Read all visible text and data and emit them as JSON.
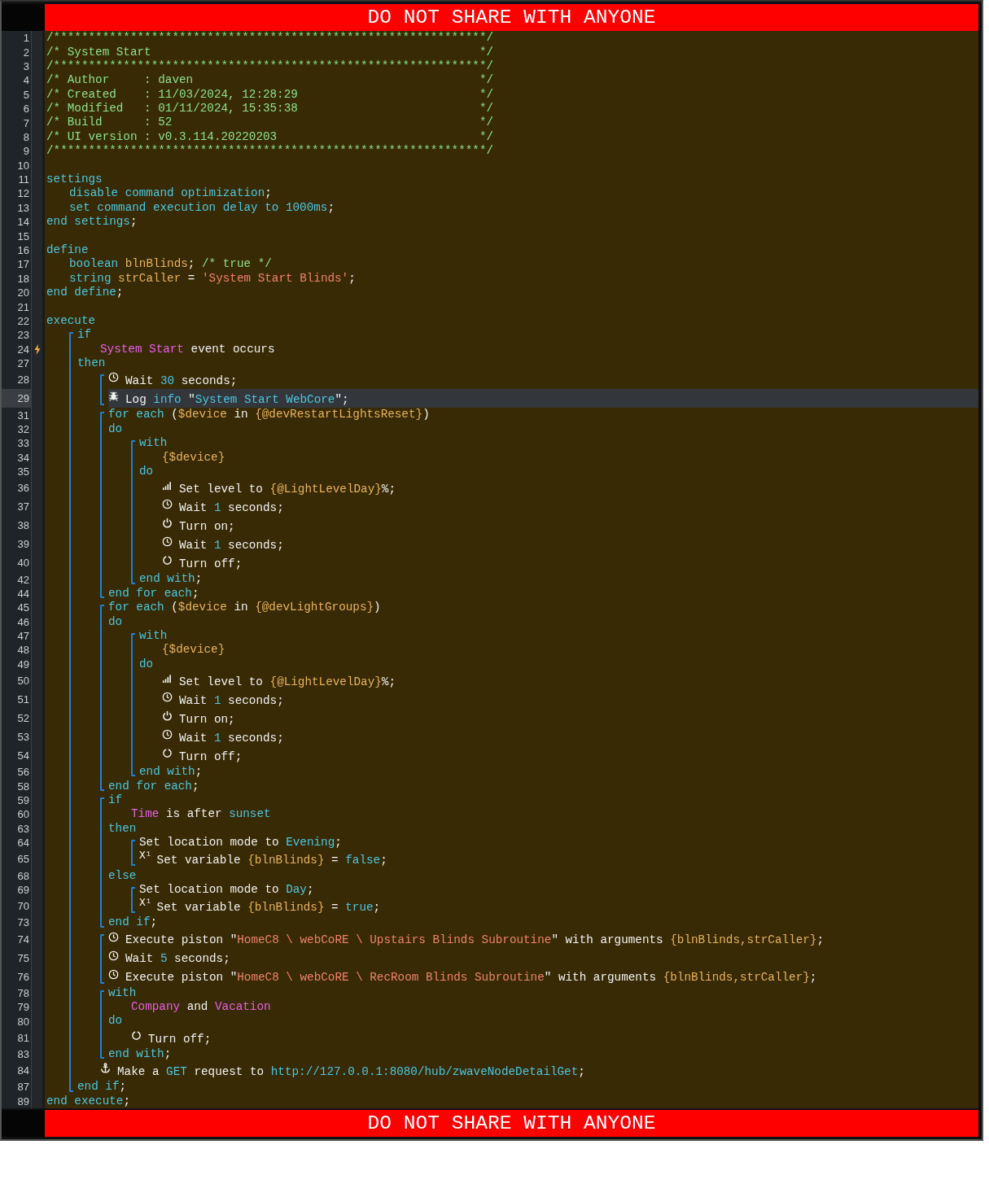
{
  "banner_top": "DO NOT SHARE WITH ANYONE",
  "code": [
    {
      "kind": "line",
      "num": "1",
      "highlighted": false,
      "tokens": [
        {
          "kind": "comment",
          "text": "/**************************************************************/"
        }
      ]
    },
    {
      "kind": "line",
      "num": "2",
      "highlighted": false,
      "tokens": [
        {
          "kind": "comment",
          "text": "/* System Start"
        }
      ],
      "closing": "*/"
    },
    {
      "kind": "line",
      "num": "3",
      "highlighted": false,
      "tokens": [
        {
          "kind": "comment",
          "text": "/**************************************************************/"
        }
      ]
    },
    {
      "kind": "line",
      "num": "4",
      "highlighted": false,
      "tokens": [
        {
          "kind": "comment",
          "text": "/* Author     : daven"
        }
      ],
      "closing": "*/"
    },
    {
      "kind": "line",
      "num": "5",
      "highlighted": false,
      "tokens": [
        {
          "kind": "comment",
          "text": "/* Created    : 11/03/2024, 12:28:29"
        }
      ],
      "closing": "*/"
    },
    {
      "kind": "line",
      "num": "6",
      "highlighted": false,
      "tokens": [
        {
          "kind": "comment",
          "text": "/* Modified   : 01/11/2024, 15:35:38"
        }
      ],
      "closing": "*/"
    },
    {
      "kind": "line",
      "num": "7",
      "highlighted": false,
      "tokens": [
        {
          "kind": "comment",
          "text": "/* Build      : 52"
        }
      ],
      "closing": "*/"
    },
    {
      "kind": "line",
      "num": "8",
      "highlighted": false,
      "tokens": [
        {
          "kind": "comment",
          "text": "/* UI version : v0.3.114.20220203"
        }
      ],
      "closing": "*/"
    },
    {
      "kind": "line",
      "num": "9",
      "highlighted": false,
      "tokens": [
        {
          "kind": "comment",
          "text": "/**************************************************************/"
        }
      ]
    },
    {
      "kind": "line",
      "num": "10",
      "highlighted": false
    },
    {
      "kind": "line",
      "num": "11",
      "highlighted": false,
      "tokens": [
        {
          "kind": "keyword",
          "text": "settings"
        }
      ],
      "children": [
        {
          "kind": "line",
          "num": "12",
          "highlighted": false,
          "tokens": [
            {
              "kind": "keyword",
              "text": "disable command optimization"
            },
            {
              "kind": "text",
              "text": ";"
            }
          ]
        },
        {
          "kind": "line",
          "num": "13",
          "highlighted": false,
          "tokens": [
            {
              "kind": "keyword",
              "text": "set command execution delay to 1000ms"
            },
            {
              "kind": "text",
              "text": ";"
            }
          ]
        }
      ]
    },
    {
      "kind": "line",
      "num": "14",
      "highlighted": false,
      "tokens": [
        {
          "kind": "keyword",
          "text": "end settings"
        },
        {
          "kind": "text",
          "text": ";"
        }
      ]
    },
    {
      "kind": "line",
      "num": "15",
      "highlighted": false
    },
    {
      "kind": "line",
      "num": "16",
      "highlighted": false,
      "tokens": [
        {
          "kind": "keyword",
          "text": "define"
        }
      ],
      "children": [
        {
          "kind": "line",
          "num": "17",
          "highlighted": false,
          "tokens": [
            {
              "kind": "keyword",
              "text": "boolean "
            },
            {
              "kind": "variable",
              "text": "blnBlinds"
            },
            {
              "kind": "text",
              "text": "; "
            },
            {
              "kind": "comment",
              "text": "/* true */"
            }
          ]
        },
        {
          "kind": "line",
          "num": "18",
          "highlighted": false,
          "tokens": [
            {
              "kind": "keyword",
              "text": "string "
            },
            {
              "kind": "variable",
              "text": "strCaller"
            },
            {
              "kind": "text",
              "text": " = "
            },
            {
              "kind": "string",
              "text": "'System Start Blinds'"
            },
            {
              "kind": "text",
              "text": ";"
            }
          ]
        }
      ]
    },
    {
      "kind": "line",
      "num": "20",
      "highlighted": false,
      "tokens": [
        {
          "kind": "keyword",
          "text": "end define"
        },
        {
          "kind": "text",
          "text": ";"
        }
      ]
    },
    {
      "kind": "line",
      "num": "21",
      "highlighted": false
    },
    {
      "kind": "line",
      "num": "22",
      "highlighted": false,
      "tokens": [
        {
          "kind": "keyword",
          "text": "execute"
        }
      ],
      "children": [
        {
          "kind": "block",
          "children": [
            {
              "kind": "line",
              "num": "23",
              "highlighted": false,
              "tokens": [
                {
                  "kind": "keyword",
                  "text": "if"
                }
              ],
              "children": [
                {
                  "kind": "trigger",
                  "num": "24",
                  "highlighted": false,
                  "tokens": [
                    {
                      "kind": "device",
                      "text": "System Start"
                    },
                    {
                      "kind": "text",
                      "text": " event occurs"
                    }
                  ]
                }
              ]
            },
            {
              "kind": "line",
              "num": "27",
              "highlighted": false,
              "tokens": [
                {
                  "kind": "keyword",
                  "text": "then"
                }
              ],
              "children": [
                {
                  "kind": "block",
                  "children": [
                    {
                      "kind": "wait",
                      "num": "28",
                      "highlighted": false,
                      "tokens": [
                        {
                          "kind": "text",
                          "text": "Wait "
                        },
                        {
                          "kind": "value",
                          "text": "30"
                        },
                        {
                          "kind": "text",
                          "text": " seconds;"
                        }
                      ]
                    },
                    {
                      "kind": "log",
                      "num": "29",
                      "highlighted": true,
                      "tokens": [
                        {
                          "kind": "text",
                          "text": "Log "
                        },
                        {
                          "kind": "value",
                          "text": "info"
                        },
                        {
                          "kind": "text",
                          "text": " \""
                        },
                        {
                          "kind": "value",
                          "text": "System Start WebCore"
                        },
                        {
                          "kind": "text",
                          "text": "\";"
                        }
                      ]
                    }
                  ]
                },
                {
                  "kind": "block",
                  "children": [
                    {
                      "kind": "line",
                      "num": "31",
                      "highlighted": false,
                      "tokens": [
                        {
                          "kind": "keyword",
                          "text": "for each "
                        },
                        {
                          "kind": "text",
                          "text": "("
                        },
                        {
                          "kind": "variable",
                          "text": "$device"
                        },
                        {
                          "kind": "text",
                          "text": " in "
                        },
                        {
                          "kind": "variable",
                          "text": "{@devRestartLightsReset}"
                        },
                        {
                          "kind": "text",
                          "text": ")"
                        }
                      ]
                    },
                    {
                      "kind": "line",
                      "num": "32",
                      "highlighted": false,
                      "tokens": [
                        {
                          "kind": "keyword",
                          "text": "do"
                        }
                      ],
                      "children": [
                        {
                          "kind": "block",
                          "children": [
                            {
                              "kind": "line",
                              "num": "33",
                              "highlighted": false,
                              "tokens": [
                                {
                                  "kind": "keyword",
                                  "text": "with"
                                }
                              ],
                              "children": [
                                {
                                  "kind": "line",
                                  "num": "34",
                                  "highlighted": false,
                                  "tokens": [
                                    {
                                      "kind": "variable",
                                      "text": "{$device}"
                                    }
                                  ]
                                }
                              ]
                            },
                            {
                              "kind": "line",
                              "num": "35",
                              "highlighted": false,
                              "tokens": [
                                {
                                  "kind": "keyword",
                                  "text": "do"
                                }
                              ],
                              "children": [
                                {
                                  "kind": "level",
                                  "num": "36",
                                  "highlighted": false,
                                  "tokens": [
                                    {
                                      "kind": "text",
                                      "text": "Set level to "
                                    },
                                    {
                                      "kind": "variable",
                                      "text": "{@LightLevelDay}"
                                    },
                                    {
                                      "kind": "text",
                                      "text": "%;"
                                    }
                                  ]
                                },
                                {
                                  "kind": "wait",
                                  "num": "37",
                                  "highlighted": false,
                                  "tokens": [
                                    {
                                      "kind": "text",
                                      "text": "Wait "
                                    },
                                    {
                                      "kind": "value",
                                      "text": "1"
                                    },
                                    {
                                      "kind": "text",
                                      "text": " seconds;"
                                    }
                                  ]
                                },
                                {
                                  "kind": "switch_on",
                                  "num": "38",
                                  "highlighted": false,
                                  "tokens": [
                                    {
                                      "kind": "text",
                                      "text": "Turn on;"
                                    }
                                  ]
                                },
                                {
                                  "kind": "wait",
                                  "num": "39",
                                  "highlighted": false,
                                  "tokens": [
                                    {
                                      "kind": "text",
                                      "text": "Wait "
                                    },
                                    {
                                      "kind": "value",
                                      "text": "1"
                                    },
                                    {
                                      "kind": "text",
                                      "text": " seconds;"
                                    }
                                  ]
                                },
                                {
                                  "kind": "switch_off",
                                  "num": "40",
                                  "highlighted": false,
                                  "tokens": [
                                    {
                                      "kind": "text",
                                      "text": "Turn off;"
                                    }
                                  ]
                                }
                              ]
                            },
                            {
                              "kind": "line",
                              "num": "42",
                              "highlighted": false,
                              "tokens": [
                                {
                                  "kind": "keyword",
                                  "text": "end with"
                                },
                                {
                                  "kind": "text",
                                  "text": ";"
                                }
                              ]
                            }
                          ]
                        }
                      ]
                    },
                    {
                      "kind": "line",
                      "num": "44",
                      "highlighted": false,
                      "tokens": [
                        {
                          "kind": "keyword",
                          "text": "end for each"
                        },
                        {
                          "kind": "text",
                          "text": ";"
                        }
                      ]
                    }
                  ]
                },
                {
                  "kind": "block",
                  "children": [
                    {
                      "kind": "line",
                      "num": "45",
                      "highlighted": false,
                      "tokens": [
                        {
                          "kind": "keyword",
                          "text": "for each "
                        },
                        {
                          "kind": "text",
                          "text": "("
                        },
                        {
                          "kind": "variable",
                          "text": "$device"
                        },
                        {
                          "kind": "text",
                          "text": " in "
                        },
                        {
                          "kind": "variable",
                          "text": "{@devLightGroups}"
                        },
                        {
                          "kind": "text",
                          "text": ")"
                        }
                      ]
                    },
                    {
                      "kind": "line",
                      "num": "46",
                      "highlighted": false,
                      "tokens": [
                        {
                          "kind": "keyword",
                          "text": "do"
                        }
                      ],
                      "children": [
                        {
                          "kind": "block",
                          "children": [
                            {
                              "kind": "line",
                              "num": "47",
                              "highlighted": false,
                              "tokens": [
                                {
                                  "kind": "keyword",
                                  "text": "with"
                                }
                              ],
                              "children": [
                                {
                                  "kind": "line",
                                  "num": "48",
                                  "highlighted": false,
                                  "tokens": [
                                    {
                                      "kind": "variable",
                                      "text": "{$device}"
                                    }
                                  ]
                                }
                              ]
                            },
                            {
                              "kind": "line",
                              "num": "49",
                              "highlighted": false,
                              "tokens": [
                                {
                                  "kind": "keyword",
                                  "text": "do"
                                }
                              ],
                              "children": [
                                {
                                  "kind": "level",
                                  "num": "50",
                                  "highlighted": false,
                                  "tokens": [
                                    {
                                      "kind": "text",
                                      "text": "Set level to "
                                    },
                                    {
                                      "kind": "variable",
                                      "text": "{@LightLevelDay}"
                                    },
                                    {
                                      "kind": "text",
                                      "text": "%;"
                                    }
                                  ]
                                },
                                {
                                  "kind": "wait",
                                  "num": "51",
                                  "highlighted": false,
                                  "tokens": [
                                    {
                                      "kind": "text",
                                      "text": "Wait "
                                    },
                                    {
                                      "kind": "value",
                                      "text": "1"
                                    },
                                    {
                                      "kind": "text",
                                      "text": " seconds;"
                                    }
                                  ]
                                },
                                {
                                  "kind": "switch_on",
                                  "num": "52",
                                  "highlighted": false,
                                  "tokens": [
                                    {
                                      "kind": "text",
                                      "text": "Turn on;"
                                    }
                                  ]
                                },
                                {
                                  "kind": "wait",
                                  "num": "53",
                                  "highlighted": false,
                                  "tokens": [
                                    {
                                      "kind": "text",
                                      "text": "Wait "
                                    },
                                    {
                                      "kind": "value",
                                      "text": "1"
                                    },
                                    {
                                      "kind": "text",
                                      "text": " seconds;"
                                    }
                                  ]
                                },
                                {
                                  "kind": "switch_off",
                                  "num": "54",
                                  "highlighted": false,
                                  "tokens": [
                                    {
                                      "kind": "text",
                                      "text": "Turn off;"
                                    }
                                  ]
                                }
                              ]
                            },
                            {
                              "kind": "line",
                              "num": "56",
                              "highlighted": false,
                              "tokens": [
                                {
                                  "kind": "keyword",
                                  "text": "end with"
                                },
                                {
                                  "kind": "text",
                                  "text": ";"
                                }
                              ]
                            }
                          ]
                        }
                      ]
                    },
                    {
                      "kind": "line",
                      "num": "58",
                      "highlighted": false,
                      "tokens": [
                        {
                          "kind": "keyword",
                          "text": "end for each"
                        },
                        {
                          "kind": "text",
                          "text": ";"
                        }
                      ]
                    }
                  ]
                },
                {
                  "kind": "block",
                  "children": [
                    {
                      "kind": "line",
                      "num": "59",
                      "highlighted": false,
                      "tokens": [
                        {
                          "kind": "keyword",
                          "text": "if"
                        }
                      ],
                      "children": [
                        {
                          "kind": "line",
                          "num": "60",
                          "highlighted": false,
                          "tokens": [
                            {
                              "kind": "device",
                              "text": "Time"
                            },
                            {
                              "kind": "text",
                              "text": " is after "
                            },
                            {
                              "kind": "value",
                              "text": "sunset"
                            }
                          ]
                        }
                      ]
                    },
                    {
                      "kind": "line",
                      "num": "63",
                      "highlighted": false,
                      "tokens": [
                        {
                          "kind": "keyword",
                          "text": "then"
                        }
                      ],
                      "children": [
                        {
                          "kind": "block",
                          "children": [
                            {
                              "kind": "line",
                              "num": "64",
                              "highlighted": false,
                              "tokens": [
                                {
                                  "kind": "text",
                                  "text": "Set location mode to "
                                },
                                {
                                  "kind": "value",
                                  "text": "Evening"
                                },
                                {
                                  "kind": "text",
                                  "text": ";"
                                }
                              ]
                            },
                            {
                              "kind": "variable",
                              "num": "65",
                              "highlighted": false,
                              "glyph": "X¹",
                              "tokens": [
                                {
                                  "kind": "text",
                                  "text": "Set variable "
                                },
                                {
                                  "kind": "variable",
                                  "text": "{blnBlinds}"
                                },
                                {
                                  "kind": "text",
                                  "text": " = "
                                },
                                {
                                  "kind": "value",
                                  "text": "false"
                                },
                                {
                                  "kind": "text",
                                  "text": ";"
                                }
                              ]
                            }
                          ]
                        }
                      ]
                    },
                    {
                      "kind": "line",
                      "num": "68",
                      "highlighted": false,
                      "tokens": [
                        {
                          "kind": "keyword",
                          "text": "else"
                        }
                      ],
                      "children": [
                        {
                          "kind": "block",
                          "children": [
                            {
                              "kind": "line",
                              "num": "69",
                              "highlighted": false,
                              "tokens": [
                                {
                                  "kind": "text",
                                  "text": "Set location mode to "
                                },
                                {
                                  "kind": "value",
                                  "text": "Day"
                                },
                                {
                                  "kind": "text",
                                  "text": ";"
                                }
                              ]
                            },
                            {
                              "kind": "variable",
                              "num": "70",
                              "highlighted": false,
                              "glyph": "X¹",
                              "tokens": [
                                {
                                  "kind": "text",
                                  "text": "Set variable "
                                },
                                {
                                  "kind": "variable",
                                  "text": "{blnBlinds}"
                                },
                                {
                                  "kind": "text",
                                  "text": " = "
                                },
                                {
                                  "kind": "value",
                                  "text": "true"
                                },
                                {
                                  "kind": "text",
                                  "text": ";"
                                }
                              ]
                            }
                          ]
                        }
                      ]
                    },
                    {
                      "kind": "line",
                      "num": "73",
                      "highlighted": false,
                      "tokens": [
                        {
                          "kind": "keyword",
                          "text": "end if"
                        },
                        {
                          "kind": "text",
                          "text": ";"
                        }
                      ]
                    }
                  ]
                },
                {
                  "kind": "block",
                  "children": [
                    {
                      "kind": "wait",
                      "num": "74",
                      "highlighted": false,
                      "tokens": [
                        {
                          "kind": "text",
                          "text": "Execute piston \""
                        },
                        {
                          "kind": "string",
                          "text": "HomeC8 \\ webCoRE \\ Upstairs Blinds Subroutine"
                        },
                        {
                          "kind": "text",
                          "text": "\" with arguments "
                        },
                        {
                          "kind": "variable",
                          "text": "{blnBlinds,strCaller}"
                        },
                        {
                          "kind": "text",
                          "text": ";"
                        }
                      ]
                    },
                    {
                      "kind": "wait",
                      "num": "75",
                      "highlighted": false,
                      "tokens": [
                        {
                          "kind": "text",
                          "text": "Wait "
                        },
                        {
                          "kind": "value",
                          "text": "5"
                        },
                        {
                          "kind": "text",
                          "text": " seconds;"
                        }
                      ]
                    },
                    {
                      "kind": "wait",
                      "num": "76",
                      "highlighted": false,
                      "tokens": [
                        {
                          "kind": "text",
                          "text": "Execute piston \""
                        },
                        {
                          "kind": "string",
                          "text": "HomeC8 \\ webCoRE \\ RecRoom Blinds Subroutine"
                        },
                        {
                          "kind": "text",
                          "text": "\" with arguments "
                        },
                        {
                          "kind": "variable",
                          "text": "{blnBlinds,strCaller}"
                        },
                        {
                          "kind": "text",
                          "text": ";"
                        }
                      ]
                    }
                  ]
                },
                {
                  "kind": "block",
                  "children": [
                    {
                      "kind": "line",
                      "num": "78",
                      "highlighted": false,
                      "tokens": [
                        {
                          "kind": "keyword",
                          "text": "with"
                        }
                      ],
                      "children": [
                        {
                          "kind": "line",
                          "num": "79",
                          "highlighted": false,
                          "tokens": [
                            {
                              "kind": "device",
                              "text": "Company"
                            },
                            {
                              "kind": "text",
                              "text": " and "
                            },
                            {
                              "kind": "device",
                              "text": "Vacation"
                            }
                          ]
                        }
                      ]
                    },
                    {
                      "kind": "line",
                      "num": "80",
                      "highlighted": false,
                      "tokens": [
                        {
                          "kind": "keyword",
                          "text": "do"
                        }
                      ],
                      "children": [
                        {
                          "kind": "switch_off",
                          "num": "81",
                          "highlighted": false,
                          "tokens": [
                            {
                              "kind": "text",
                              "text": "Turn off;"
                            }
                          ]
                        }
                      ]
                    },
                    {
                      "kind": "line",
                      "num": "83",
                      "highlighted": false,
                      "tokens": [
                        {
                          "kind": "keyword",
                          "text": "end with"
                        },
                        {
                          "kind": "text",
                          "text": ";"
                        }
                      ]
                    }
                  ]
                },
                {
                  "kind": "request",
                  "num": "84",
                  "highlighted": false,
                  "tokens": [
                    {
                      "kind": "text",
                      "text": "Make a "
                    },
                    {
                      "kind": "value",
                      "text": "GET"
                    },
                    {
                      "kind": "text",
                      "text": " request to "
                    },
                    {
                      "kind": "value",
                      "text": "http://127.0.0.1:8080/hub/zwaveNodeDetailGet"
                    },
                    {
                      "kind": "text",
                      "text": ";"
                    }
                  ]
                }
              ]
            },
            {
              "kind": "line",
              "num": "87",
              "highlighted": false,
              "tokens": [
                {
                  "kind": "keyword",
                  "text": "end if"
                },
                {
                  "kind": "text",
                  "text": ";"
                }
              ]
            }
          ]
        }
      ]
    },
    {
      "kind": "line",
      "num": "89",
      "highlighted": false,
      "tokens": [
        {
          "kind": "keyword",
          "text": "end execute"
        },
        {
          "kind": "text",
          "text": ";"
        }
      ]
    }
  ],
  "banner_bottom": "DO NOT SHARE WITH ANYONE"
}
